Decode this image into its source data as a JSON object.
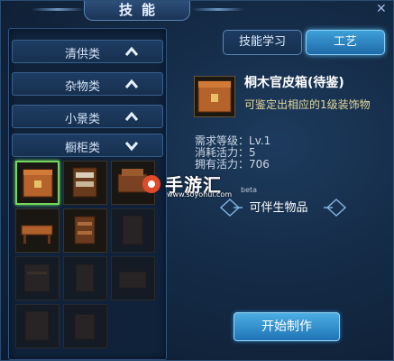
{
  "window": {
    "title": "技能",
    "close_glyph": "✕"
  },
  "categories": [
    {
      "label": "清供类",
      "state": "collapsed"
    },
    {
      "label": "杂物类",
      "state": "collapsed"
    },
    {
      "label": "小景类",
      "state": "collapsed"
    },
    {
      "label": "橱柜类",
      "state": "expanded"
    }
  ],
  "tabs": {
    "skill_learn": "技能学习",
    "craft": "工艺"
  },
  "item": {
    "name": "桐木官皮箱(待鉴)",
    "description": "可鉴定出相应的1级装饰物"
  },
  "requirements": {
    "level_label": "需求等级：",
    "level_value": "Lv.1",
    "cost_label": "消耗活力：",
    "cost_value": "5",
    "own_label": "拥有活力：",
    "own_value": "706"
  },
  "companion_label": "可伴生物品",
  "start_button": "开始制作",
  "watermark": {
    "text": "手游汇",
    "url": "www.soyohui.com",
    "beta": "beta"
  },
  "colors": {
    "accent": "#4fb4ea",
    "selected_border": "#74d65e",
    "desc_text": "#e6d89a"
  }
}
